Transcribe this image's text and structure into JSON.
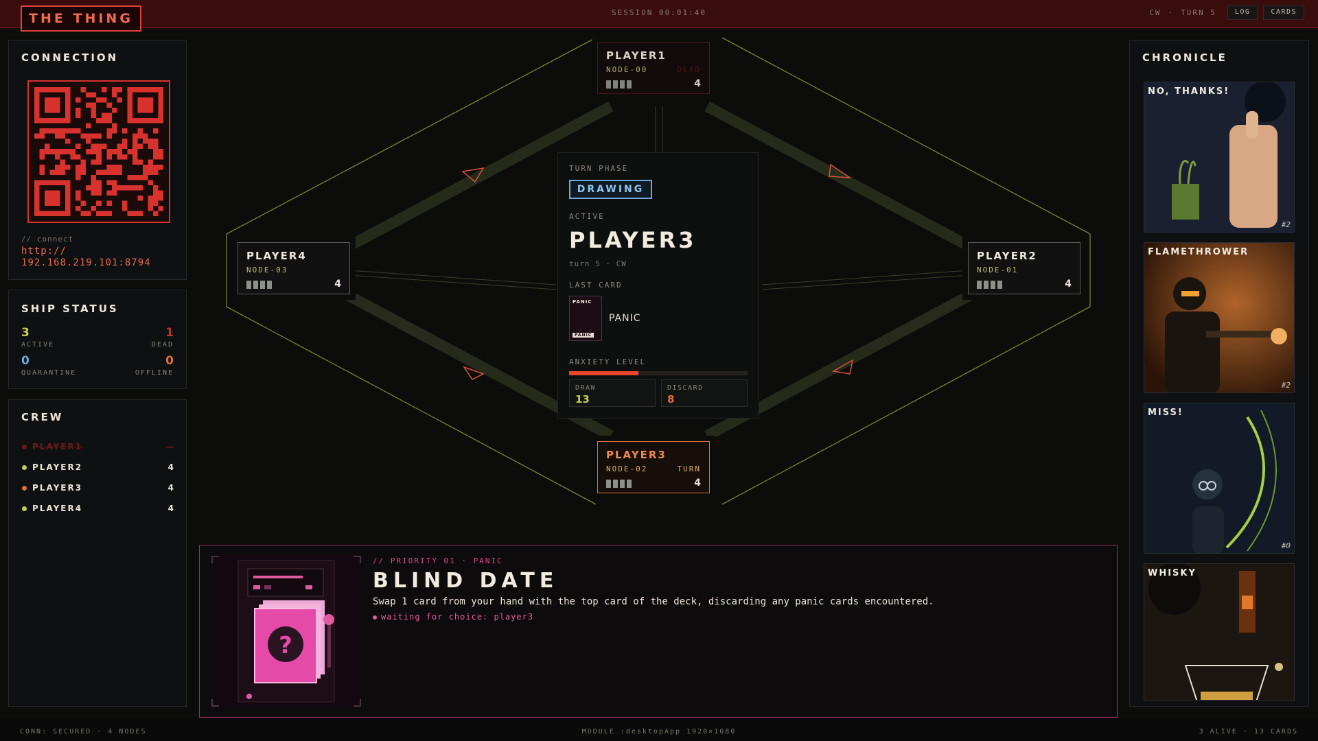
{
  "app": {
    "title": "THE THING"
  },
  "topbar": {
    "session": "SESSION  00:01:40",
    "direction": "CW",
    "separator": "·",
    "turn": "TURN 5",
    "log_label": "LOG",
    "cards_label": "CARDS"
  },
  "connection": {
    "title": "CONNECTION",
    "label": "// connect",
    "url_line1": "http://",
    "url_line2": "192.168.219.101:8794"
  },
  "ship_status": {
    "title": "SHIP STATUS",
    "active_value": "3",
    "active_label": "ACTIVE",
    "dead_value": "1",
    "dead_label": "DEAD",
    "quarantine_value": "0",
    "quarantine_label": "QUARANTINE",
    "offline_value": "0",
    "offline_label": "OFFLINE"
  },
  "crew": {
    "title": "CREW",
    "members": [
      {
        "name": "PLAYER1",
        "count": "—",
        "status": "dead"
      },
      {
        "name": "PLAYER2",
        "count": "4",
        "status": "alive"
      },
      {
        "name": "PLAYER3",
        "count": "4",
        "status": "active"
      },
      {
        "name": "PLAYER4",
        "count": "4",
        "status": "alive"
      }
    ]
  },
  "board": {
    "nodes": {
      "top": {
        "name": "PLAYER1",
        "node": "NODE-00",
        "tag": "DEAD",
        "count": "4"
      },
      "left": {
        "name": "PLAYER4",
        "node": "NODE-03",
        "tag": "",
        "count": "4"
      },
      "right": {
        "name": "PLAYER2",
        "node": "NODE-01",
        "tag": "",
        "count": "4"
      },
      "bottom": {
        "name": "PLAYER3",
        "node": "NODE-02",
        "tag": "TURN",
        "count": "4"
      }
    },
    "center": {
      "phase_label": "TURN PHASE",
      "phase": "DRAWING",
      "active_label": "ACTIVE",
      "active_player": "PLAYER3",
      "turn_line": "turn 5   ·   CW",
      "last_card_label": "LAST CARD",
      "last_card_mini_top": "PANIC",
      "last_card_mini_bottom": "PANIC",
      "last_card": "PANIC",
      "anxiety_label": "ANXIETY LEVEL",
      "anxiety_fraction": 0.39,
      "draw_label": "DRAW",
      "draw_value": "13",
      "discard_label": "DISCARD",
      "discard_value": "8"
    }
  },
  "prompt": {
    "meta": "// PRIORITY 01 · PANIC",
    "title": "BLIND DATE",
    "description": "Swap 1 card from your hand with the top card of the deck, discarding any panic cards encountered.",
    "waiting": "waiting for choice: player3"
  },
  "chronicle": {
    "title": "CHRONICLE",
    "cards": [
      {
        "title": "NO, THANKS!",
        "number": "#2"
      },
      {
        "title": "FLAMETHROWER",
        "number": "#2"
      },
      {
        "title": "MISS!",
        "number": "#0"
      },
      {
        "title": "WHISKY",
        "number": ""
      }
    ]
  },
  "footer": {
    "left": "CONN: SECURED · 4 NODES",
    "center": "MODULE :desktopApp  1920×1080",
    "right": "3 ALIVE · 13 CARDS"
  },
  "colors": {
    "accent_red": "#e0413a",
    "phase_blue": "#6fa8d8",
    "active_orange": "#e0713f",
    "panic_pink": "#d04b90",
    "alive_green": "#c6d04a",
    "quarantine_blue": "#6fa8d8",
    "offline_orange": "#e0713f"
  },
  "icons": {
    "phase": "none",
    "prompt_card": "question-mark-card-icon"
  }
}
